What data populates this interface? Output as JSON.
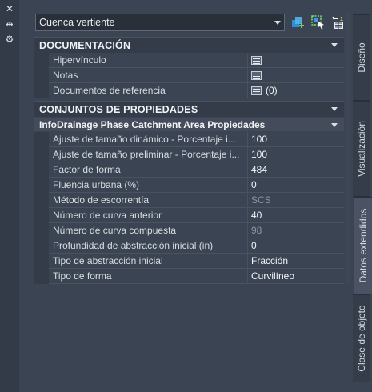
{
  "window": {
    "close_glyph": "✕",
    "pin_glyph": "⇹",
    "settings_glyph": "⚙"
  },
  "selector": {
    "value": "Cuenca vertiente"
  },
  "toolbar": {
    "icons": [
      "quick-select-icon",
      "select-objects-icon",
      "toggle-pickadd-icon"
    ]
  },
  "sections": {
    "documentacion": {
      "title": "DOCUMENTACIÓN",
      "rows": [
        {
          "label": "Hipervínculo",
          "value": ""
        },
        {
          "label": "Notas",
          "value": ""
        },
        {
          "label": "Documentos de referencia",
          "value": "(0)"
        }
      ]
    },
    "conjuntos": {
      "title": "CONJUNTOS DE PROPIEDADES",
      "subgroup_title": "InfoDrainage Phase Catchment Area Propiedades",
      "rows": [
        {
          "label": "Ajuste de tamaño dinámico - Porcentaje i...",
          "value": "100",
          "dim": false
        },
        {
          "label": "Ajuste de tamaño preliminar - Porcentaje i...",
          "value": "100",
          "dim": false
        },
        {
          "label": "Factor de forma",
          "value": "484",
          "dim": false
        },
        {
          "label": "Fluencia urbana (%)",
          "value": "0",
          "dim": false
        },
        {
          "label": "Método de escorrentía",
          "value": "SCS",
          "dim": true
        },
        {
          "label": "Número de curva anterior",
          "value": "40",
          "dim": false
        },
        {
          "label": "Número de curva compuesta",
          "value": "98",
          "dim": true
        },
        {
          "label": "Profundidad de abstracción inicial (in)",
          "value": "0",
          "dim": false
        },
        {
          "label": "Tipo de abstracción inicial",
          "value": "Fracción",
          "dim": false
        },
        {
          "label": "Tipo de forma",
          "value": "Curvilíneo",
          "dim": false
        }
      ]
    }
  },
  "tabs": [
    {
      "label": "Diseño",
      "active": false
    },
    {
      "label": "Visualización",
      "active": false
    },
    {
      "label": "Datos extendidos",
      "active": true
    },
    {
      "label": "Clase de objeto",
      "active": false
    }
  ]
}
